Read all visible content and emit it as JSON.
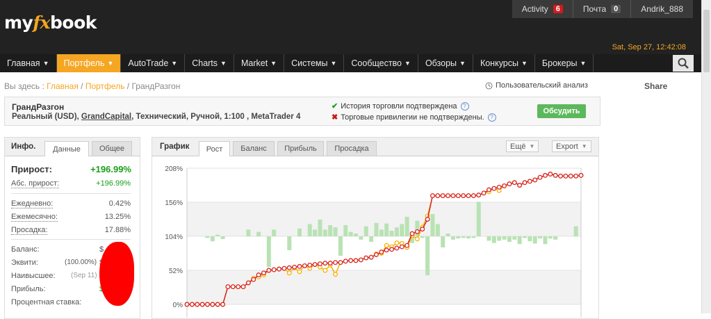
{
  "header": {
    "logo": {
      "pre": "my",
      "fx": "fx",
      "post": "book"
    },
    "activity": {
      "label": "Activity",
      "count": "6"
    },
    "mail": {
      "label": "Почта",
      "count": "0"
    },
    "username": "Andrik_888",
    "datetime": "Sat, Sep 27, 12:42:08"
  },
  "nav": {
    "items": [
      {
        "label": "Главная",
        "arrow": "▼"
      },
      {
        "label": "Портфель",
        "arrow": "▼",
        "active": true
      },
      {
        "label": "AutoTrade",
        "arrow": "▼"
      },
      {
        "label": "Charts",
        "arrow": "▼"
      },
      {
        "label": "Market",
        "arrow": "▼"
      },
      {
        "label": "Системы",
        "arrow": "▼"
      },
      {
        "label": "Сообщество",
        "arrow": "▼"
      },
      {
        "label": "Обзоры",
        "arrow": "▼"
      },
      {
        "label": "Конкурсы",
        "arrow": "▼"
      },
      {
        "label": "Брокеры",
        "arrow": "▼"
      }
    ]
  },
  "breadcrumb": {
    "prefix": "Вы здесь : ",
    "home": "Главная",
    "sep": " / ",
    "portfolio": "Портфель",
    "current": "ГрандРазгон"
  },
  "analysis_label": "Пользовательский анализ",
  "share_label": "Share",
  "system": {
    "name": "ГрандРазгон",
    "desc_pre": "Реальный (USD), ",
    "broker": "GrandCapital",
    "desc_post": ", Технический, Ручной, 1:100 , MetaTrader 4",
    "verified_history": "История торговли подтверждена",
    "verified_privileges": "Торговые привилегии не подтверждены.",
    "discuss_button": "Обсудить"
  },
  "info_panel": {
    "title": "Инфо.",
    "tabs": [
      "Данные",
      "Общее"
    ],
    "gain_label": "Прирост:",
    "gain_value": "+196.99%",
    "abs_gain_label": "Абс. прирост:",
    "abs_gain_value": "+196.99%",
    "daily_label": "Ежедневно:",
    "daily_value": "0.42%",
    "monthly_label": "Ежемесячно:",
    "monthly_value": "13.25%",
    "drawdown_label": "Просадка:",
    "drawdown_value": "17.88%",
    "balance_label": "Баланс:",
    "equity_label": "Эквити:",
    "equity_pct": "(100.00%)",
    "highest_label": "Наивысшее:",
    "highest_date": "(Sep 11)",
    "profit_label": "Прибыль:",
    "interest_label": "Процентная ставка:",
    "value_prefix_balance": "$",
    "value_prefix_equity": "$",
    "value_prefix_highest": "$",
    "value_prefix_profit": "$"
  },
  "chart_panel": {
    "title": "График",
    "tabs": [
      "Рост",
      "Баланс",
      "Прибыль",
      "Просадка"
    ],
    "more_button": "Ещё",
    "export_button": "Export"
  },
  "chart_data": {
    "type": "line",
    "y_ticks": [
      "208%",
      "156%",
      "104%",
      "52%",
      "0%"
    ],
    "ylim": [
      0,
      208
    ],
    "series": [
      {
        "color": "#d62728",
        "values": [
          0,
          0,
          0,
          0,
          0,
          0,
          0,
          0,
          27,
          27,
          27,
          27,
          33,
          38,
          45,
          48,
          52,
          53,
          54,
          55,
          56,
          57,
          58,
          59,
          60,
          61,
          62,
          63,
          63,
          64,
          64,
          66,
          67,
          67,
          68,
          71,
          72,
          76,
          80,
          83,
          84,
          86,
          88,
          90,
          108,
          111,
          115,
          130,
          166,
          166,
          166,
          166,
          166,
          166,
          166,
          166,
          166,
          167,
          170,
          175,
          177,
          179,
          181,
          184,
          186,
          182,
          186,
          188,
          190,
          194,
          197,
          199,
          197,
          196,
          196,
          196,
          196,
          197
        ]
      },
      {
        "color": "#f5b400",
        "values": [
          0,
          0,
          0,
          0,
          0,
          0,
          0,
          0,
          27,
          27,
          27,
          27,
          33,
          40,
          42,
          45,
          52,
          53,
          54,
          55,
          48,
          56,
          50,
          59,
          55,
          61,
          57,
          52,
          60,
          46,
          64,
          66,
          67,
          67,
          68,
          71,
          72,
          77,
          78,
          90,
          88,
          94,
          93,
          87,
          105,
          100,
          118,
          135,
          166,
          166,
          166,
          166,
          166,
          166,
          166,
          166,
          166,
          167,
          170,
          172,
          177,
          174,
          181,
          184,
          186,
          182,
          186,
          188,
          190,
          194,
          197,
          199,
          197,
          196,
          196,
          196,
          196,
          197
        ]
      }
    ],
    "bars_color": "#b9e2b4",
    "bars": [
      0,
      0,
      0,
      0,
      -3,
      -9,
      3,
      -5,
      0,
      0,
      0,
      0,
      12,
      0,
      8,
      0,
      -55,
      12,
      0,
      0,
      -25,
      0,
      14,
      0,
      22,
      12,
      30,
      12,
      20,
      16,
      -35,
      20,
      8,
      5,
      -6,
      18,
      -10,
      24,
      12,
      23,
      10,
      16,
      22,
      35,
      -12,
      28,
      -3,
      -70,
      40,
      22,
      -20,
      5,
      -6,
      -4,
      -3,
      -4,
      -3,
      62,
      0,
      -8,
      -12,
      -8,
      -6,
      -10,
      -6,
      -14,
      -3,
      -9,
      -13,
      -4,
      -14,
      -4,
      -6,
      0,
      0,
      0,
      18
    ]
  }
}
